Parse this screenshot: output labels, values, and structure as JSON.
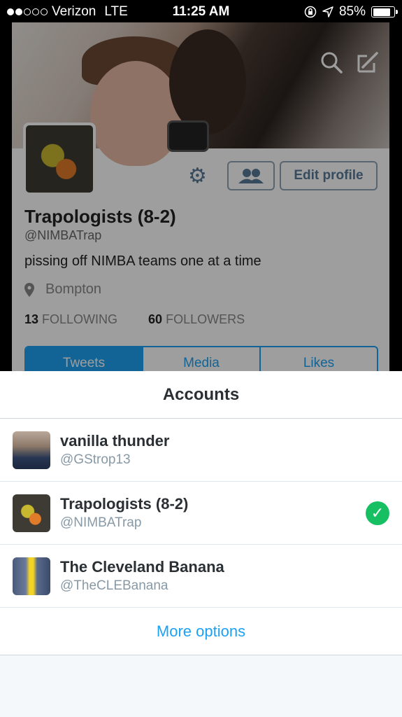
{
  "status_bar": {
    "carrier": "Verizon",
    "network": "LTE",
    "time": "11:25 AM",
    "battery": "85%",
    "battery_level": 0.85,
    "signal_bars": 2,
    "signal_total": 5
  },
  "profile": {
    "name": "Trapologists (8-2)",
    "handle": "@NIMBATrap",
    "bio": "pissing off NIMBA teams one at a time",
    "location": "Bompton",
    "following_count": "13",
    "following_label": "FOLLOWING",
    "followers_count": "60",
    "followers_label": "FOLLOWERS",
    "edit_profile_label": "Edit profile",
    "tabs": [
      {
        "label": "Tweets",
        "active": true
      },
      {
        "label": "Media",
        "active": false
      },
      {
        "label": "Likes",
        "active": false
      }
    ]
  },
  "accounts_sheet": {
    "title": "Accounts",
    "accounts": [
      {
        "name": "vanilla thunder",
        "handle": "@GStrop13",
        "selected": false
      },
      {
        "name": "Trapologists (8-2)",
        "handle": "@NIMBATrap",
        "selected": true
      },
      {
        "name": "The Cleveland Banana",
        "handle": "@TheCLEBanana",
        "selected": false
      }
    ],
    "more_options_label": "More options"
  },
  "colors": {
    "accent": "#1da1f2",
    "check": "#17bf63"
  }
}
